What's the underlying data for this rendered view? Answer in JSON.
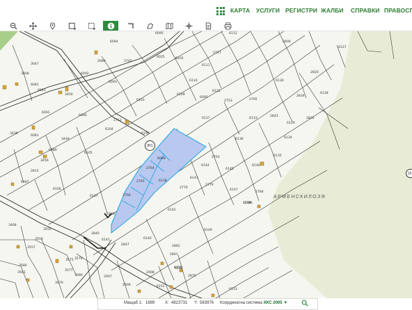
{
  "nav": {
    "items": [
      "КАРТА",
      "УСЛУГИ",
      "РЕГИСТРИ",
      "ЖАЛБИ",
      "СПРАВКИ",
      "ПРАВОСПОСОБНОСТ"
    ]
  },
  "toolbar": {
    "tools": [
      "zoom-out-icon",
      "pan-icon",
      "location-pin-icon",
      "select-rect-icon",
      "select-polygon-icon",
      "info-icon",
      "measure-length-icon",
      "measure-area-icon",
      "map-layers-icon",
      "coordinates-icon",
      "document-icon",
      "print-icon"
    ],
    "active": "info-icon"
  },
  "map": {
    "district_label": "АРМЕНСКИЛОЗЯ",
    "road_badge": "801",
    "road_badge_right": "15",
    "parcel_labels": [
      "6095",
      "6094",
      "6112",
      "2806",
      "6127",
      "2727",
      "6111",
      "6025",
      "6102",
      "2689",
      "2702",
      "3047",
      "3408",
      "6092",
      "6093",
      "6110",
      "2820",
      "6081",
      "6021",
      "3450",
      "6130",
      "6128",
      "6103",
      "6109",
      "6122",
      "2834",
      "6091",
      "6090",
      "6095",
      "2753",
      "2795",
      "2843",
      "3436",
      "6137",
      "6133",
      "6129",
      "2822",
      "2712",
      "6104",
      "6190",
      "6081",
      "3449",
      "6105",
      "6136",
      "6134",
      "6089",
      "3456",
      "6088",
      "2763",
      "6145",
      "6146",
      "2812",
      "6135",
      "6144",
      "6087",
      "2764",
      "6138",
      "6143",
      "2779",
      "2784",
      "6106",
      "2765",
      "2776",
      "6147",
      "2786",
      "6107",
      "2766",
      "6148",
      "6142",
      "6139",
      "2840",
      "6141",
      "3468",
      "3555",
      "3558",
      "6149",
      "6140",
      "2847",
      "3557",
      "2862",
      "3576",
      "3580",
      "3575",
      "2861",
      "3561",
      "3577",
      "6150",
      "6152",
      "3579",
      "2908",
      "2907",
      "2909",
      "3580",
      "6151",
      "2875",
      "6153",
      "2911",
      "2910"
    ],
    "highlighted_parcels": [
      "2763",
      "2764",
      "6138",
      "2765",
      "2766"
    ]
  },
  "statusbar": {
    "scale_label": "Мащаб 1:",
    "scale_value": "1689",
    "x_label": "X:",
    "x_value": "4823731",
    "y_label": "Y:",
    "y_value": "583976",
    "crs_label": "Координатна система:",
    "crs_value": "ККС 2005"
  },
  "colors": {
    "accent": "#2e8b3e",
    "highlight_fill": "#b9c8ef",
    "highlight_stroke": "#29a8e0",
    "building": "#d9a83a",
    "open_area": "#e8ecd6",
    "forest": "#a8cf8a"
  }
}
